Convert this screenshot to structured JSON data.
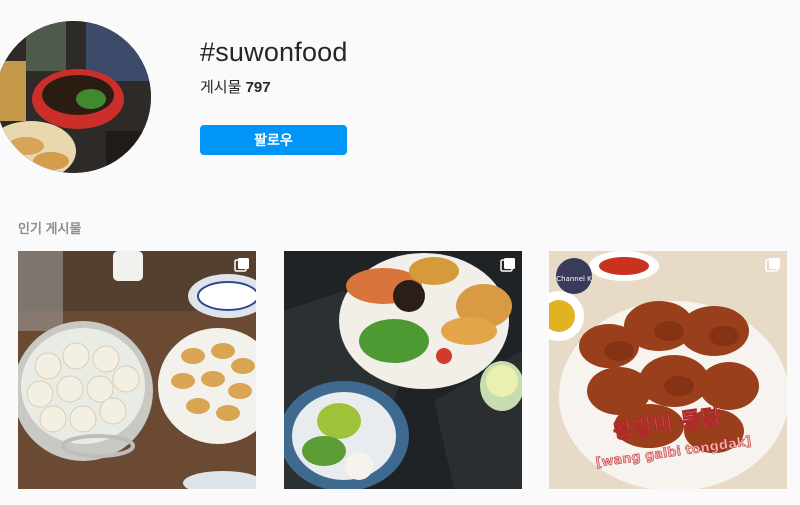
{
  "header": {
    "hashtag": "#suwonfood",
    "posts_label": "게시물",
    "posts_count": "797",
    "follow_label": "팔로우"
  },
  "top_posts": {
    "title": "인기 게시물",
    "items": [
      {
        "description": "xiaolongbao steamer and dumplings",
        "icon": "multiple-posts-icon"
      },
      {
        "description": "brunch plate with salad and avocado",
        "icon": "multiple-posts-icon"
      },
      {
        "description": "fried chicken wings",
        "overlay_text_1": "왕갈비 통닭",
        "overlay_text_2": "[wang galbi tongdak]",
        "badge_text": "Channel K",
        "icon": "multiple-posts-icon"
      }
    ]
  },
  "colors": {
    "accent": "#0095f6",
    "text": "#262626",
    "muted": "#8e8e8e",
    "background": "#fafafa"
  }
}
